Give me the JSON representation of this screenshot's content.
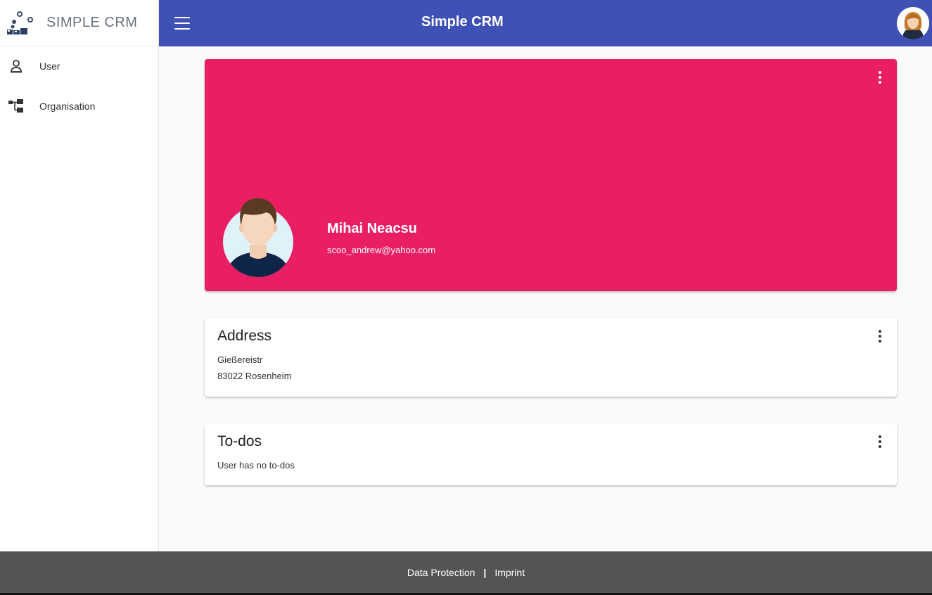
{
  "brand": {
    "name": "SIMPLE CRM",
    "logo_icon": "crm-logo-icon"
  },
  "sidebar": {
    "items": [
      {
        "label": "User",
        "icon": "user-icon"
      },
      {
        "label": "Organisation",
        "icon": "organisation-icon"
      }
    ]
  },
  "topbar": {
    "title": "Simple CRM",
    "menu_icon": "hamburger-menu-icon",
    "avatar_icon": "profile-avatar-icon",
    "color": "#3f51b5"
  },
  "profile": {
    "name": "Mihai Neacsu",
    "email": "scoo_andrew@yahoo.com",
    "card_color": "#e91e63",
    "avatar_icon": "user-avatar-icon"
  },
  "address": {
    "title": "Address",
    "street": "Gießereistr",
    "city": "83022 Rosenheim"
  },
  "todos": {
    "title": "To-dos",
    "empty_text": "User has no to-dos"
  },
  "footer": {
    "data_protection": "Data Protection",
    "separator": "|",
    "imprint": "Imprint"
  }
}
